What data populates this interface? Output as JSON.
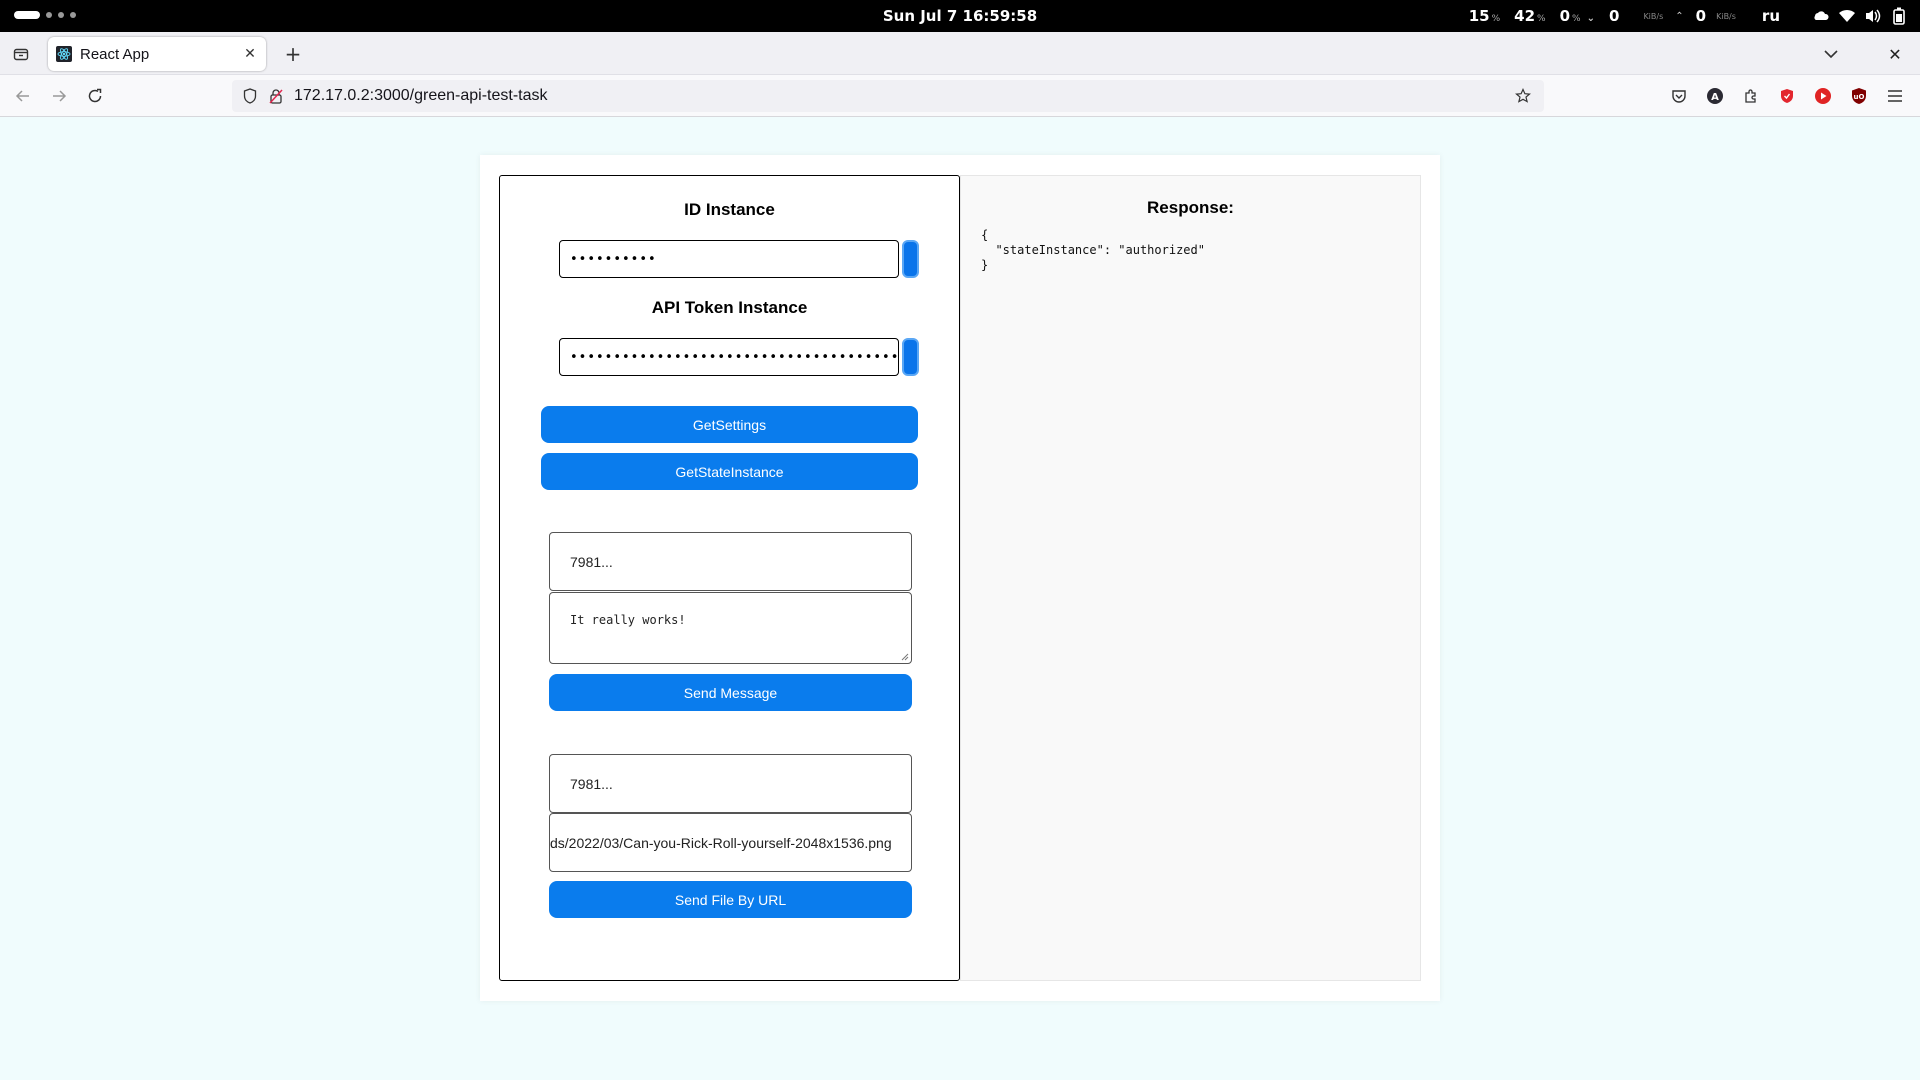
{
  "system_bar": {
    "clock": "Sun Jul 7  16:59:58",
    "cpu_value": "15",
    "cpu_unit": "%",
    "mem_value": "42",
    "mem_unit": "%",
    "swap_value": "0",
    "swap_unit": "%",
    "net_down_value": "0",
    "net_down_unit": "KiB/s",
    "net_up_value": "0",
    "net_up_unit": "KiB/s",
    "keyboard_layout": "ru"
  },
  "browser": {
    "tab_title": "React App",
    "url": "172.17.0.2:3000/green-api-test-task"
  },
  "form": {
    "id_instance_heading": "ID Instance",
    "id_instance_value": "••••••••••",
    "api_token_heading": "API Token Instance",
    "api_token_value": "•••••••••••••••••••••••••••••••••••••••••••••••••",
    "get_settings_label": "GetSettings",
    "get_state_label": "GetStateInstance",
    "message_phone_value": "7981...",
    "message_text_value": "It really works!",
    "send_message_label": "Send Message",
    "file_phone_value": "7981...",
    "file_url_value": "ds/2022/03/Can-you-Rick-Roll-yourself-2048x1536.png",
    "send_file_label": "Send File By URL"
  },
  "response": {
    "title": "Response:",
    "body": "{\n  \"stateInstance\": \"authorized\"\n}"
  }
}
